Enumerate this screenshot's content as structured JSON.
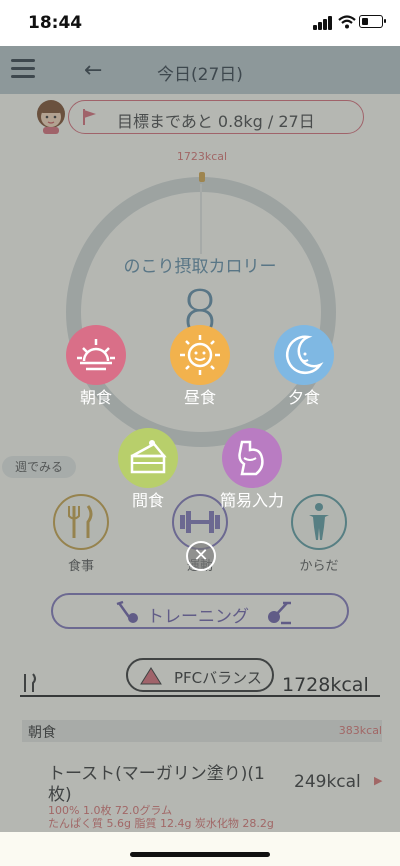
{
  "status": {
    "time": "18:44"
  },
  "header": {
    "title": "今日(27日)"
  },
  "goal": {
    "text": "目標まであと 0.8kg / 27日"
  },
  "ring": {
    "target_kcal": "1723kcal",
    "label": "のこり摂取カロリー",
    "remaining": "8"
  },
  "week_button": "週でみる",
  "categories": [
    {
      "label": "食事"
    },
    {
      "label": "運動"
    },
    {
      "label": "からだ"
    }
  ],
  "training": {
    "label": "トレーニング"
  },
  "pfc": {
    "label": "PFCバランス",
    "total": "1728kcal"
  },
  "section": {
    "name": "朝食",
    "kcal": "383kcal"
  },
  "item": {
    "name": "トースト(マーガリン塗り)(1枚)",
    "kcal": "249kcal",
    "detail1": "100%  1.0枚  72.0グラム",
    "detail2": "たんぱく質 5.6g  脂質 12.4g  炭水化物 28.2g"
  },
  "meal_menu": {
    "items": [
      {
        "label": "朝食",
        "icon": "sunrise-icon",
        "color": "#d96f88"
      },
      {
        "label": "昼食",
        "icon": "sun-icon",
        "color": "#f2b24d"
      },
      {
        "label": "夕食",
        "icon": "moon-icon",
        "color": "#7fb8e3"
      },
      {
        "label": "間食",
        "icon": "cake-icon",
        "color": "#b8cf6b"
      },
      {
        "label": "簡易入力",
        "icon": "body-icon",
        "color": "#b97cc2"
      }
    ]
  },
  "colors": {
    "header": "#b7c4c8",
    "accent": "#d86a76",
    "ring_text": "#5d8aa5",
    "purple": "#7f74b8"
  }
}
